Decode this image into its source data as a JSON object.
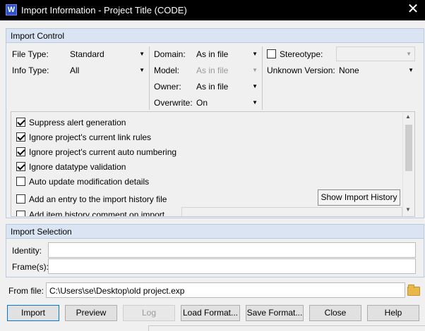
{
  "window": {
    "app_letter": "W",
    "title": "Import Information - Project Title (CODE)",
    "close_glyph": "✕"
  },
  "import_control": {
    "header": "Import Control",
    "file_type": {
      "label": "File Type:",
      "value": "Standard"
    },
    "info_type": {
      "label": "Info Type:",
      "value": "All"
    },
    "domain": {
      "label": "Domain:",
      "value": "As in file"
    },
    "model": {
      "label": "Model:",
      "value": "As in file"
    },
    "owner": {
      "label": "Owner:",
      "value": "As in file"
    },
    "overwrite": {
      "label": "Overwrite:",
      "value": "On"
    },
    "stereotype": {
      "label": "Stereotype:",
      "value": ""
    },
    "unknown_version": {
      "label": "Unknown Version:",
      "value": "None"
    },
    "options": [
      {
        "label": "Suppress alert generation",
        "checked": true
      },
      {
        "label": "Ignore project's current link rules",
        "checked": true
      },
      {
        "label": "Ignore project's current auto numbering",
        "checked": true
      },
      {
        "label": "Ignore datatype validation",
        "checked": true
      },
      {
        "label": "Auto update modification details",
        "checked": false
      },
      {
        "label": "Add an entry to the import history file",
        "checked": false
      },
      {
        "label": "Add item history comment on import",
        "checked": false
      }
    ],
    "show_history_button": "Show Import History"
  },
  "import_selection": {
    "header": "Import Selection",
    "identity_label": "Identity:",
    "frames_label": "Frame(s):"
  },
  "from_file": {
    "label": "From file:",
    "value": "C:\\Users\\se\\Desktop\\old project.exp"
  },
  "buttons": {
    "import": "Import",
    "preview": "Preview",
    "log": "Log",
    "load_format": "Load Format...",
    "save_format": "Save Format...",
    "close": "Close",
    "help": "Help"
  }
}
